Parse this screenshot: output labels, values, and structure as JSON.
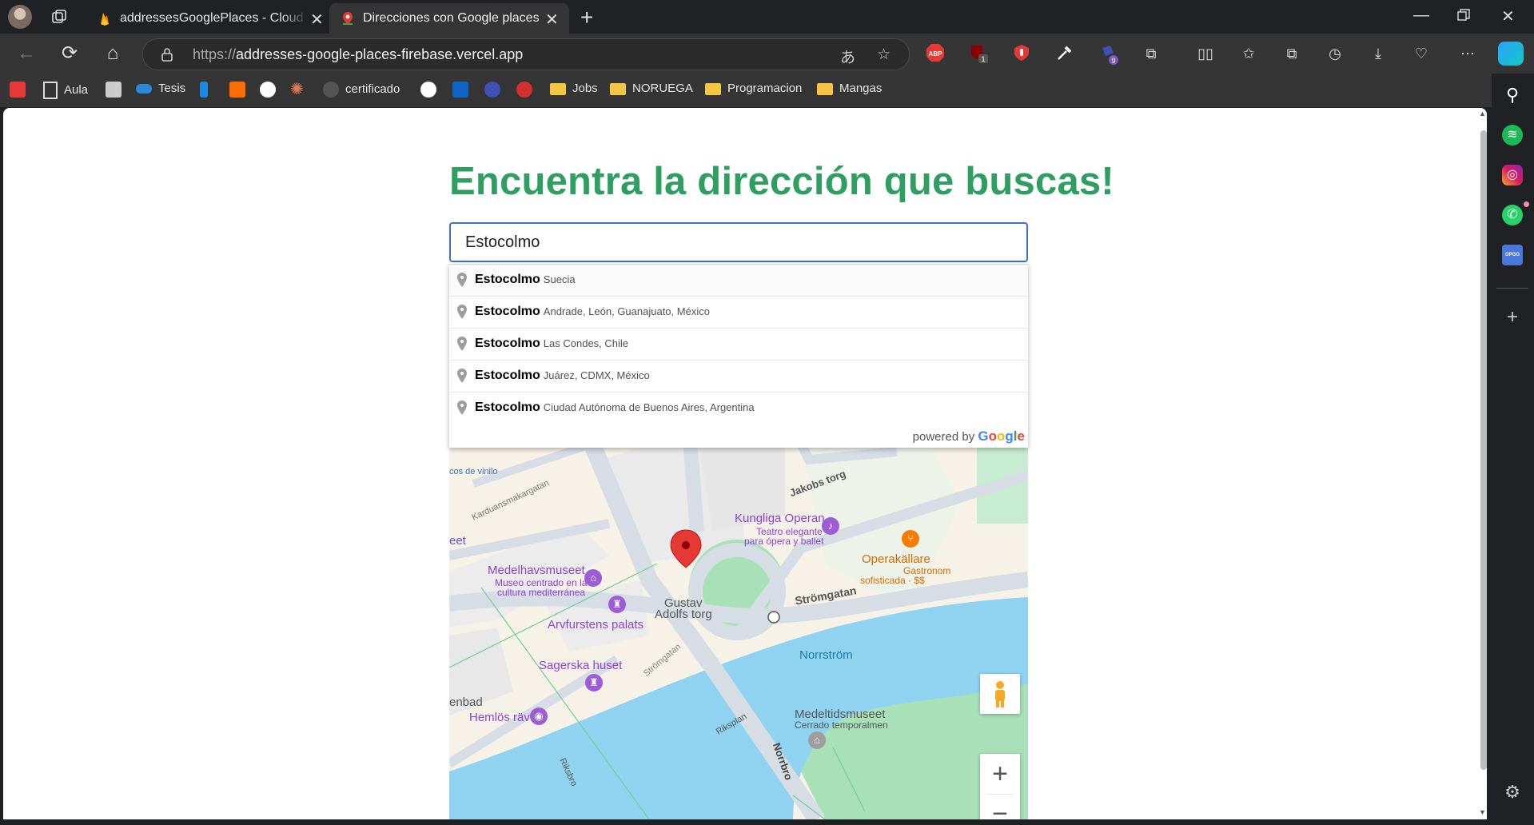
{
  "browser": {
    "tabs": [
      {
        "title": "addressesGooglePlaces - Cloud F",
        "active": false
      },
      {
        "title": "Direcciones con Google places",
        "active": true
      }
    ],
    "url_scheme": "https://",
    "url_host": "addresses-google-places-firebase.vercel.app",
    "extension_badges": {
      "ublock": "1",
      "shape": "9"
    },
    "bookmarks": [
      {
        "label": "",
        "icon": "youtube-studio-icon"
      },
      {
        "label": "Aula",
        "icon": "page-icon"
      },
      {
        "label": "",
        "icon": "book-icon"
      },
      {
        "label": "Tesis",
        "icon": "onedrive-icon"
      },
      {
        "label": "",
        "icon": "feather-icon"
      },
      {
        "label": "",
        "icon": "m-logo-icon"
      },
      {
        "label": "",
        "icon": "openai-icon"
      },
      {
        "label": "",
        "icon": "claude-icon"
      },
      {
        "label": "certificado",
        "icon": "globe-icon"
      },
      {
        "label": "",
        "icon": "github-icon"
      },
      {
        "label": "",
        "icon": "linkedin-icon"
      },
      {
        "label": "",
        "icon": "app-icon"
      },
      {
        "label": "",
        "icon": "1k-icon"
      },
      {
        "label": "Jobs",
        "icon": "folder-icon"
      },
      {
        "label": "NORUEGA",
        "icon": "folder-icon"
      },
      {
        "label": "Programacion",
        "icon": "folder-icon"
      },
      {
        "label": "Mangas",
        "icon": "folder-icon"
      }
    ],
    "sidebar_badge": "OPGG"
  },
  "page": {
    "heading": "Encuentra la dirección que buscas!",
    "search_value": "Estocolmo",
    "suggestions": [
      {
        "main": "Estocolmo",
        "secondary": "Suecia"
      },
      {
        "main": "Estocolmo",
        "secondary": "Andrade, León, Guanajuato, México"
      },
      {
        "main": "Estocolmo",
        "secondary": "Las Condes, Chile"
      },
      {
        "main": "Estocolmo",
        "secondary": "Juárez, CDMX, México"
      },
      {
        "main": "Estocolmo",
        "secondary": "Ciudad Autónoma de Buenos Aires, Argentina"
      }
    ],
    "powered_by": "powered by",
    "google": "Google"
  },
  "map": {
    "labels": {
      "vinilo": "cos de vinilo",
      "karduan": "Karduansmakargatan",
      "eet": "eet",
      "jakobs": "Jakobs torg",
      "opera_name": "Kungliga Operan",
      "opera_desc1": "Teatro elegante",
      "opera_desc2": "para ópera y ballet",
      "operakallare": "Operakällare",
      "operakallare_desc1": "Gastronom",
      "operakallare_desc2": "sofisticada · $$",
      "medelhavs_name": "Medelhavsmuseet",
      "medelhavs_desc1": "Museo centrado en la",
      "medelhavs_desc2": "cultura mediterránea",
      "gustav1": "Gustav",
      "gustav2": "Adolfs torg",
      "stromgatan": "Strömgatan",
      "stromgatan2": "Strömgatan",
      "arvfurstens": "Arvfurstens palats",
      "norrstrom": "Norrström",
      "sagerska": "Sagerska huset",
      "enbad": "enbad",
      "hemlos": "Hemlös räv",
      "medeltids": "Medeltidsmuseet",
      "medeltids_desc": "Cerrado temporalmen",
      "riksplan": "Riksplan",
      "riksbron": "Riksbro",
      "norrbro": "Norrbro"
    },
    "zoom_in": "+",
    "zoom_out": "−"
  },
  "colors": {
    "heading": "#2e9e61",
    "input_border": "#3b73c4",
    "water": "#8fd3f0",
    "park": "#a8e0b8",
    "road": "#d6dde5",
    "poi_purple": "#9d5dd6",
    "marker_red": "#e53935"
  }
}
